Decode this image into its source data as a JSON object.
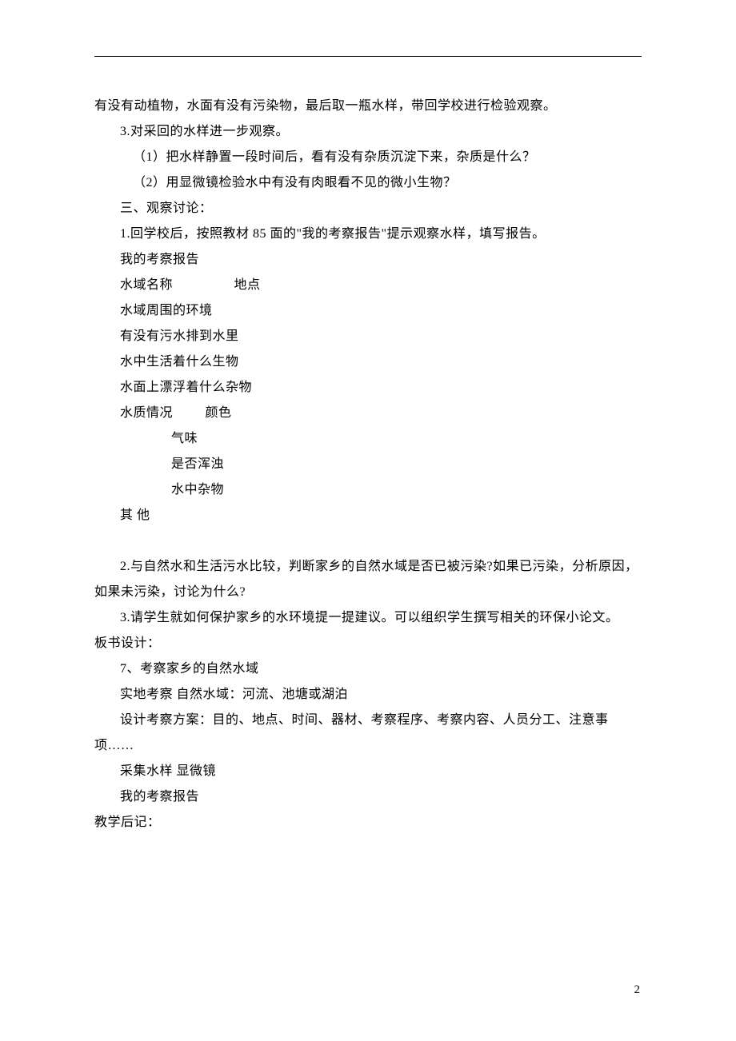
{
  "page": {
    "hr": "",
    "lines": {
      "l1": "有没有动植物，水面有没有污染物，最后取一瓶水样，带回学校进行检验观察。",
      "l2": "3.对采回的水样进一步观察。",
      "l3": "（1）把水样静置一段时间后，看有没有杂质沉淀下来，杂质是什么？",
      "l4": "（2）用显微镜检验水中有没有肉眼看不见的微小生物？",
      "l5": "三、观察讨论：",
      "l6": "1.回学校后，按照教材 85 面的\"我的考察报告\"提示观察水样，填写报告。",
      "l7": "我的考察报告",
      "l8": "水域名称                 地点",
      "l9": "水域周围的环境",
      "l10": "有没有污水排到水里",
      "l11": "水中生活着什么生物",
      "l12": "水面上漂浮着什么杂物",
      "l13": "水质情况         颜色",
      "l14": "气味",
      "l15": "是否浑浊",
      "l16": "水中杂物",
      "l17": "其 他",
      "l18": "2.与自然水和生活污水比较，判断家乡的自然水域是否已被污染?如果已污染，分析原因，如果未污染，讨论为什么?",
      "l19": "3.请学生就如何保护家乡的水环境提一提建议。可以组织学生撰写相关的环保小论文。",
      "l20": "板书设计：",
      "l21": "7、考察家乡的自然水域",
      "l22": "实地考察  自然水域：河流、池塘或湖泊",
      "l23": "设计考察方案：目的、地点、时间、器材、考察程序、考察内容、人员分工、注意事项……",
      "l24": "采集水样   显微镜",
      "l25": "我的考察报告",
      "l26": "教学后记："
    },
    "page_number": "2"
  }
}
